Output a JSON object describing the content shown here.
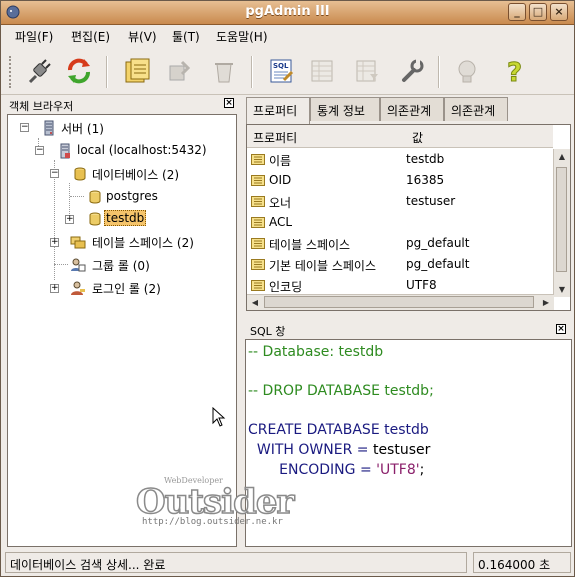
{
  "window": {
    "title": "pgAdmin III"
  },
  "menu": [
    "파일(F)",
    "편집(E)",
    "뷰(V)",
    "툴(T)",
    "도움말(H)"
  ],
  "toolbar": [
    {
      "icon": "plug-icon",
      "enabled": true
    },
    {
      "icon": "refresh-icon",
      "enabled": true
    },
    {
      "icon": "properties-icon",
      "enabled": true
    },
    {
      "icon": "create-object-icon",
      "enabled": false
    },
    {
      "icon": "drop-object-icon",
      "enabled": false
    },
    {
      "icon": "sql-query-icon",
      "enabled": true
    },
    {
      "icon": "view-data-icon",
      "enabled": false
    },
    {
      "icon": "filtered-data-icon",
      "enabled": false
    },
    {
      "icon": "maintenance-icon",
      "enabled": true
    },
    {
      "icon": "plugin-icon",
      "enabled": false
    },
    {
      "icon": "help-icon",
      "enabled": true
    }
  ],
  "browser": {
    "title": "객체 브라우저",
    "nodes": {
      "servers": "서버 (1)",
      "local": "local (localhost:5432)",
      "databases": "데이터베이스 (2)",
      "postgres": "postgres",
      "testdb": "testdb",
      "tablespaces": "테이블 스페이스 (2)",
      "group_roles": "그룹 롤 (0)",
      "login_roles": "로그인 롤 (2)"
    }
  },
  "tabs": [
    "프로퍼티",
    "통계 정보",
    "의존관계",
    "의존관계"
  ],
  "properties": {
    "headers": [
      "프로퍼티",
      "값"
    ],
    "rows": [
      {
        "k": "이름",
        "v": "testdb"
      },
      {
        "k": "OID",
        "v": "16385"
      },
      {
        "k": "오너",
        "v": "testuser"
      },
      {
        "k": "ACL",
        "v": ""
      },
      {
        "k": "테이블 스페이스",
        "v": "pg_default"
      },
      {
        "k": "기본 테이블 스페이스",
        "v": "pg_default"
      },
      {
        "k": "인코딩",
        "v": "UTF8"
      }
    ]
  },
  "sql": {
    "title": "SQL 창",
    "line1": "-- Database: testdb",
    "line2": "-- DROP DATABASE testdb;",
    "line3": "CREATE DATABASE testdb",
    "line4a": "  WITH OWNER = ",
    "line4b": "testuser",
    "line5a": "       ENCODING = ",
    "line5b": "'UTF8'",
    "line5c": ";"
  },
  "watermark": {
    "brand": "Outsider",
    "tag": "WebDeveloper",
    "url": "http://blog.outsider.ne.kr"
  },
  "status": {
    "message": "데이터베이스 검색 상세... 완료",
    "time": "0.164000 초"
  }
}
